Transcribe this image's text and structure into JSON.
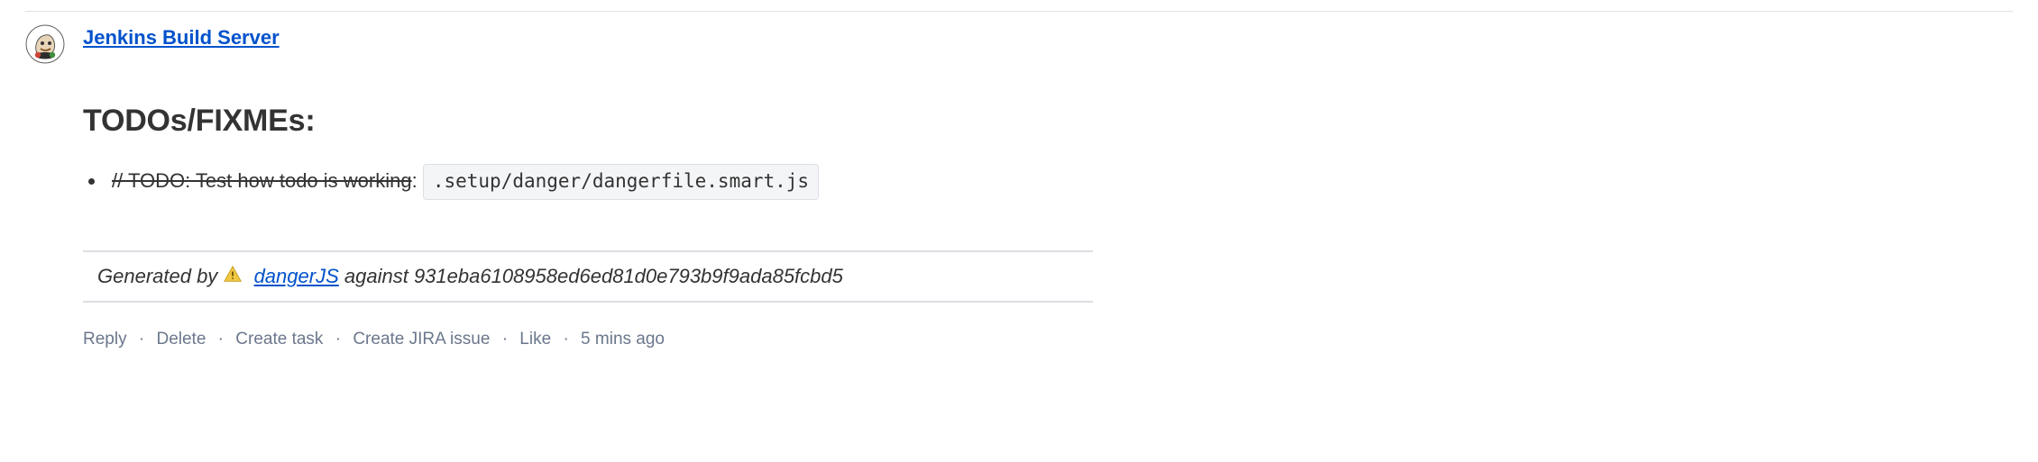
{
  "author": {
    "name": "Jenkins Build Server"
  },
  "heading": "TODOs/FIXMEs:",
  "todo": {
    "struck_text": "// TODO: Test how todo is working",
    "after_colon": ":",
    "file_chip": ".setup/danger/dangerfile.smart.js"
  },
  "generated": {
    "prefix": "Generated by ",
    "tool_name": "dangerJS",
    "mid": " against ",
    "sha": "931eba6108958ed6ed81d0e793b9f9ada85fcbd5"
  },
  "actions": {
    "reply": "Reply",
    "delete": "Delete",
    "create_task": "Create task",
    "create_jira": "Create JIRA issue",
    "like": "Like",
    "timestamp": "5 mins ago"
  }
}
